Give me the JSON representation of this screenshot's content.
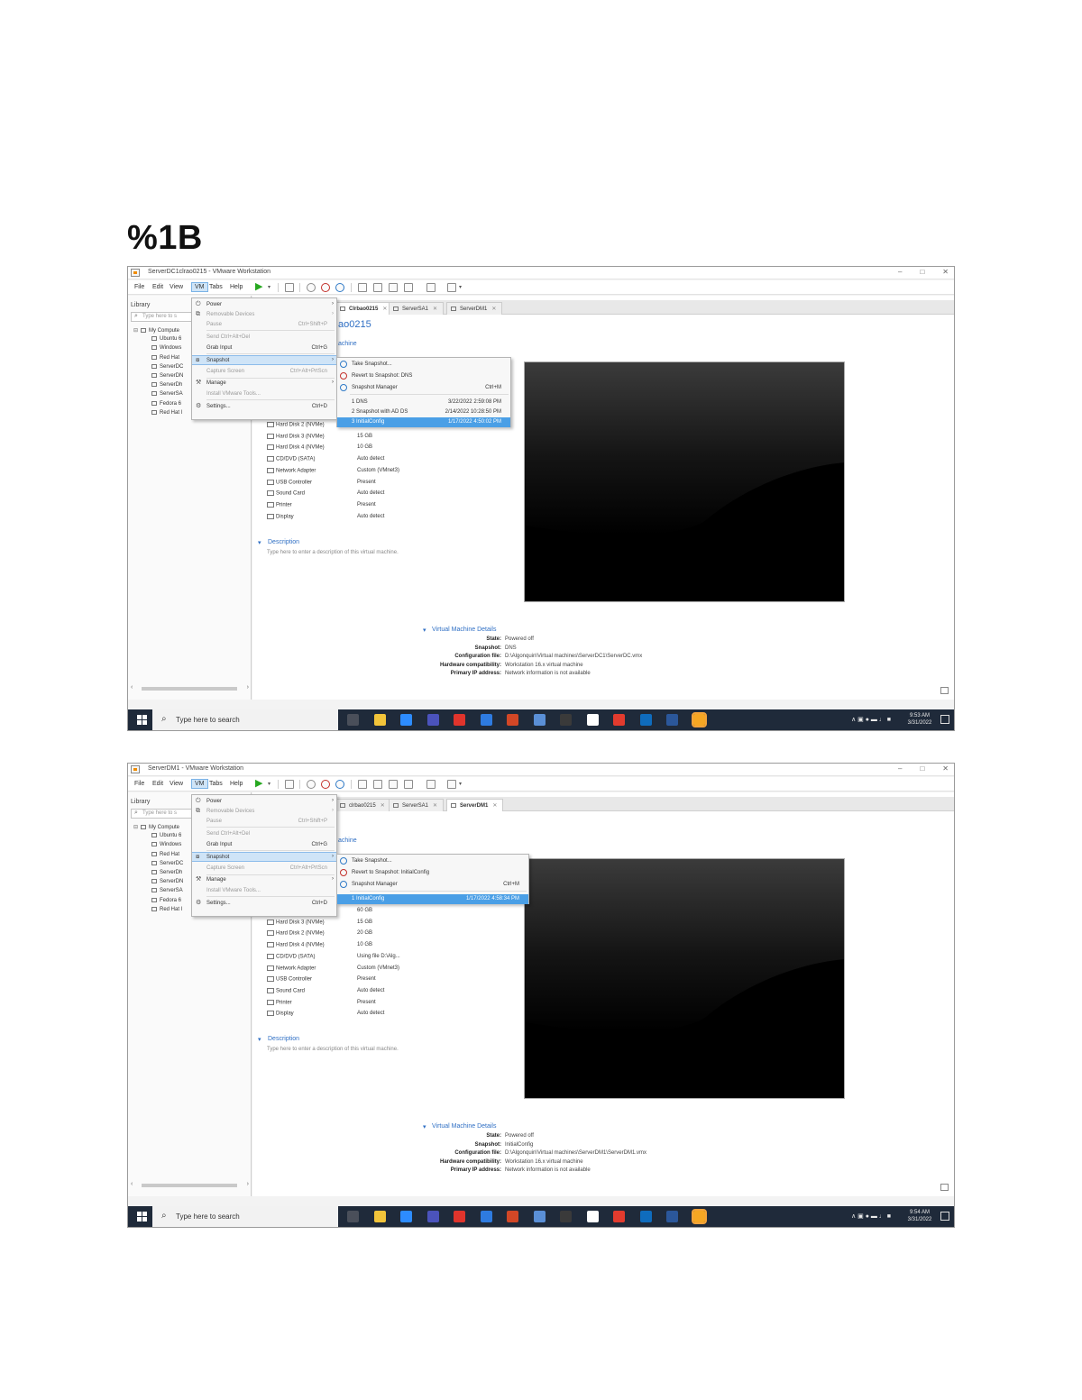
{
  "page": {
    "heading": "%1B"
  },
  "shots": [
    {
      "window_title": "ServerDC1clrao0215 - VMware Workstation",
      "menu_bar": [
        "File",
        "Edit",
        "View",
        "VM",
        "Tabs",
        "Help"
      ],
      "library": {
        "title": "Library",
        "search_placeholder": "Type here to s",
        "tree": [
          "My Compute",
          "Ubuntu 6",
          "Windows",
          "Red Hat",
          "ServerDC",
          "ServerDN",
          "ServerDh",
          "ServerSA",
          "Fedora 6",
          "Red Hat l"
        ]
      },
      "tabs": [
        {
          "label": "Clrbao0215",
          "active": true
        },
        {
          "label": "ServerSA1",
          "active": false
        },
        {
          "label": "ServerDM1",
          "active": false
        }
      ],
      "vm_name": "ao0215",
      "section_link": "achine",
      "devices": [
        {
          "name": "Hard Disk 2 (NVMe)",
          "value": ""
        },
        {
          "name": "Hard Disk 3 (NVMe)",
          "value": "15 GB"
        },
        {
          "name": "Hard Disk 4 (NVMe)",
          "value": "10 GB"
        },
        {
          "name": "CD/DVD (SATA)",
          "value": "Auto detect"
        },
        {
          "name": "Network Adapter",
          "value": "Custom (VMnet3)"
        },
        {
          "name": "USB Controller",
          "value": "Present"
        },
        {
          "name": "Sound Card",
          "value": "Auto detect"
        },
        {
          "name": "Printer",
          "value": "Present"
        },
        {
          "name": "Display",
          "value": "Auto detect"
        }
      ],
      "description": {
        "head": "Description",
        "text": "Type here to enter a description of this virtual machine."
      },
      "details": {
        "head": "Virtual Machine Details",
        "rows": [
          {
            "label": "State:",
            "value": "Powered off"
          },
          {
            "label": "Snapshot:",
            "value": "DNS"
          },
          {
            "label": "Configuration file:",
            "value": "D:\\Algonquin\\Virtual machines\\ServerDC1\\ServerDC.vmx"
          },
          {
            "label": "Hardware compatibility:",
            "value": "Workstation 16.x virtual machine"
          },
          {
            "label": "Primary IP address:",
            "value": "Network information is not available"
          }
        ]
      },
      "vm_menu": [
        {
          "label": "Power",
          "sub": true,
          "disabled": false
        },
        {
          "label": "Removable Devices",
          "sub": true,
          "disabled": true
        },
        {
          "label": "Pause",
          "shortcut": "Ctrl+Shift+P",
          "disabled": true
        },
        {
          "label": "Send Ctrl+Alt+Del",
          "disabled": true
        },
        {
          "label": "Grab Input",
          "shortcut": "Ctrl+G",
          "disabled": false
        },
        {
          "label": "Snapshot",
          "sub": true,
          "highlight": true
        },
        {
          "label": "Capture Screen",
          "shortcut": "Ctrl+Alt+PrtScn",
          "disabled": true
        },
        {
          "label": "Manage",
          "sub": true,
          "disabled": false
        },
        {
          "label": "Install VMware Tools...",
          "disabled": true
        },
        {
          "label": "Settings...",
          "shortcut": "Ctrl+D",
          "disabled": false
        }
      ],
      "snapshot_menu": {
        "items": [
          {
            "label": "Take Snapshot...",
            "shortcut": ""
          },
          {
            "label": "Revert to Snapshot: DNS",
            "shortcut": ""
          },
          {
            "label": "Snapshot Manager",
            "shortcut": "Ctrl+M"
          }
        ],
        "list": [
          {
            "label": "1  DNS",
            "date": "3/22/2022 2:59:08 PM",
            "highlight": false
          },
          {
            "label": "2  Snapshot with AD DS",
            "date": "2/14/2022 10:28:50 PM",
            "highlight": false
          },
          {
            "label": "3  InitialConfig",
            "date": "1/17/2022 4:50:02 PM",
            "highlight": true
          }
        ]
      },
      "taskbar": {
        "search": "Type here to search",
        "time": "9:53 AM",
        "date": "3/31/2022"
      }
    },
    {
      "window_title": "ServerDM1 - VMware Workstation",
      "menu_bar": [
        "File",
        "Edit",
        "View",
        "VM",
        "Tabs",
        "Help"
      ],
      "library": {
        "title": "Library",
        "search_placeholder": "Type here to s",
        "tree": [
          "My Compute",
          "Ubuntu 6",
          "Windows",
          "Red Hat",
          "ServerDC",
          "ServerDh",
          "ServerDN",
          "ServerSA",
          "Fedora 6",
          "Red Hat l"
        ]
      },
      "tabs": [
        {
          "label": "clrbao0215",
          "active": false
        },
        {
          "label": "ServerSA1",
          "active": false
        },
        {
          "label": "ServerDM1",
          "active": true
        }
      ],
      "vm_name": "",
      "section_link": "achine",
      "devices": [
        {
          "name": "",
          "value": "60 GB"
        },
        {
          "name": "Hard Disk 3 (NVMe)",
          "value": "15 GB"
        },
        {
          "name": "Hard Disk 2 (NVMe)",
          "value": "20 GB"
        },
        {
          "name": "Hard Disk 4 (NVMe)",
          "value": "10 GB"
        },
        {
          "name": "CD/DVD (SATA)",
          "value": "Using file D:\\Alg..."
        },
        {
          "name": "Network Adapter",
          "value": "Custom (VMnet3)"
        },
        {
          "name": "USB Controller",
          "value": "Present"
        },
        {
          "name": "Sound Card",
          "value": "Auto detect"
        },
        {
          "name": "Printer",
          "value": "Present"
        },
        {
          "name": "Display",
          "value": "Auto detect"
        }
      ],
      "description": {
        "head": "Description",
        "text": "Type here to enter a description of this virtual machine."
      },
      "details": {
        "head": "Virtual Machine Details",
        "rows": [
          {
            "label": "State:",
            "value": "Powered off"
          },
          {
            "label": "Snapshot:",
            "value": "InitialConfig"
          },
          {
            "label": "Configuration file:",
            "value": "D:\\Algonquin\\Virtual machines\\ServerDM1\\ServerDM1.vmx"
          },
          {
            "label": "Hardware compatibility:",
            "value": "Workstation 16.x virtual machine"
          },
          {
            "label": "Primary IP address:",
            "value": "Network information is not available"
          }
        ]
      },
      "vm_menu": [
        {
          "label": "Power",
          "sub": true,
          "disabled": false
        },
        {
          "label": "Removable Devices",
          "sub": true,
          "disabled": true
        },
        {
          "label": "Pause",
          "shortcut": "Ctrl+Shift+P",
          "disabled": true
        },
        {
          "label": "Send Ctrl+Alt+Del",
          "disabled": true
        },
        {
          "label": "Grab Input",
          "shortcut": "Ctrl+G",
          "disabled": false
        },
        {
          "label": "Snapshot",
          "sub": true,
          "highlight": true
        },
        {
          "label": "Capture Screen",
          "shortcut": "Ctrl+Alt+PrtScn",
          "disabled": true
        },
        {
          "label": "Manage",
          "sub": true,
          "disabled": false
        },
        {
          "label": "Install VMware Tools...",
          "disabled": true
        },
        {
          "label": "Settings...",
          "shortcut": "Ctrl+D",
          "disabled": false
        }
      ],
      "snapshot_menu": {
        "items": [
          {
            "label": "Take Snapshot...",
            "shortcut": ""
          },
          {
            "label": "Revert to Snapshot: InitialConfig",
            "shortcut": ""
          },
          {
            "label": "Snapshot Manager",
            "shortcut": "Ctrl+M"
          }
        ],
        "list": [
          {
            "label": "1  InitialConfig",
            "date": "1/17/2022 4:58:34 PM",
            "highlight": true
          }
        ]
      },
      "taskbar": {
        "search": "Type here to search",
        "time": "9:54 AM",
        "date": "3/31/2022"
      }
    }
  ],
  "colors": {
    "accent": "#2f6fc4",
    "taskbar": "#1f2a3a",
    "menu_highlight": "#4a9fe6",
    "play": "#27a820"
  },
  "icons": {
    "start": "windows-start-icon",
    "search": "search-icon",
    "play": "play-icon",
    "taskbar_apps": [
      "task-view-icon",
      "file-explorer-icon",
      "zoom-icon",
      "teams-icon",
      "acrobat-icon",
      "paint-icon",
      "powerpoint-icon",
      "meet-icon",
      "terminal-icon",
      "settings-icon",
      "chrome-icon",
      "outlook-icon",
      "word-icon",
      "vmware-icon"
    ]
  }
}
